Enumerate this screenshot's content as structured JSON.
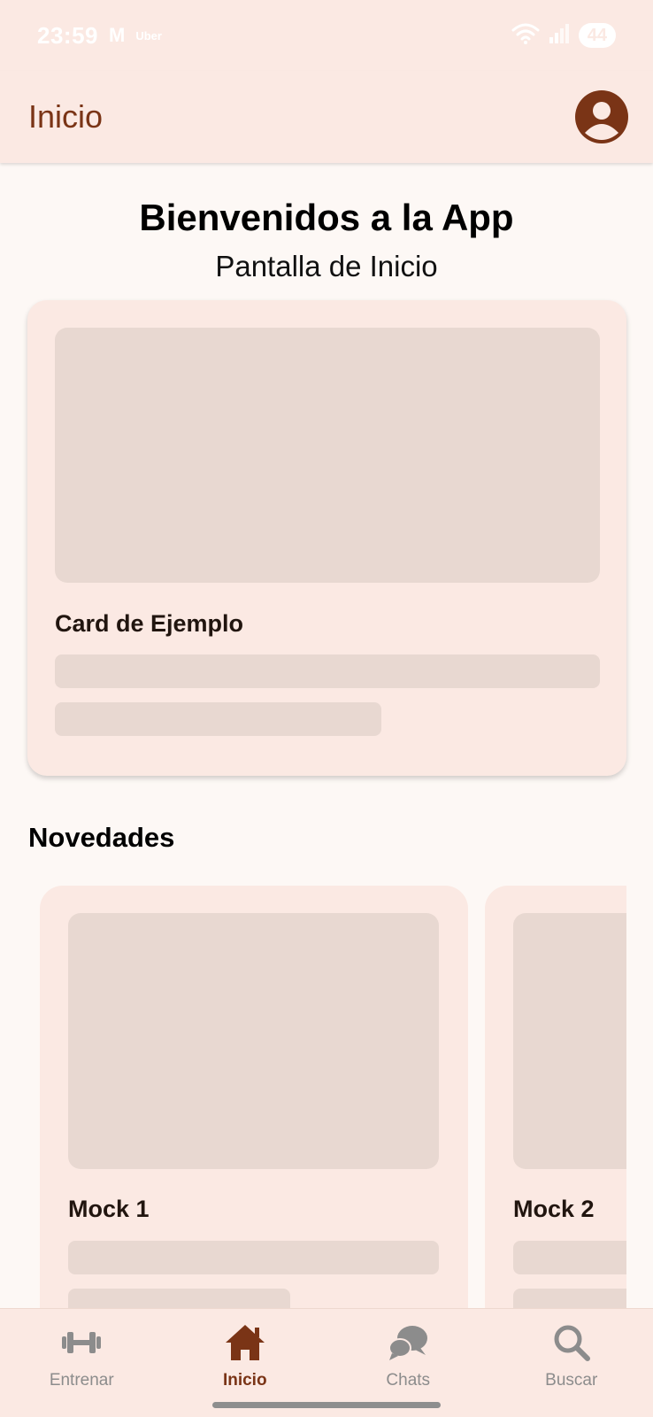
{
  "status_bar": {
    "time": "23:59",
    "mail_glyph": "M",
    "notif_app": "Uber",
    "battery": "44",
    "icons": [
      "wifi-icon",
      "signal-icon"
    ]
  },
  "app_bar": {
    "title": "Inicio",
    "avatar_icon": "account-circle-icon"
  },
  "header": {
    "title": "Bienvenidos a la App",
    "subtitle": "Pantalla de Inicio"
  },
  "main_card": {
    "title": "Card de Ejemplo"
  },
  "news": {
    "section_title": "Novedades",
    "items": [
      {
        "title": "Mock 1"
      },
      {
        "title": "Mock 2"
      }
    ]
  },
  "bottom_nav": {
    "items": [
      {
        "label": "Entrenar",
        "icon": "dumbbell-icon",
        "active": false
      },
      {
        "label": "Inicio",
        "icon": "home-icon",
        "active": true
      },
      {
        "label": "Chats",
        "icon": "chat-icon",
        "active": false
      },
      {
        "label": "Buscar",
        "icon": "search-icon",
        "active": false
      }
    ]
  },
  "colors": {
    "primary": "#7a3416",
    "surface": "#fbe9e3",
    "background": "#fdf8f5",
    "placeholder": "#e8d8d1",
    "inactive": "#8c8c8c"
  }
}
